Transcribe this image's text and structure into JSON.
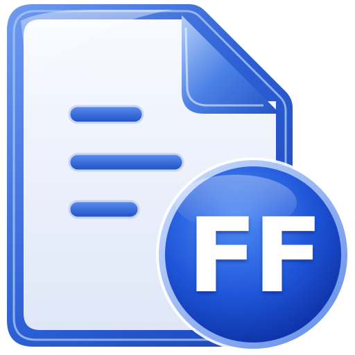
{
  "icon": {
    "name": "document-ff-icon",
    "badge_text": "FF",
    "document_lines": 3
  },
  "colors": {
    "frame_blue": "#2a5fd6",
    "frame_light": "#9fc0f5",
    "paper": "#eef2fb",
    "fold_blue": "#3f76e0",
    "line_blue": "#2f63d4",
    "badge_dark": "#0b2fa8",
    "badge_light": "#3f7bf0",
    "badge_text": "#ffffff"
  }
}
